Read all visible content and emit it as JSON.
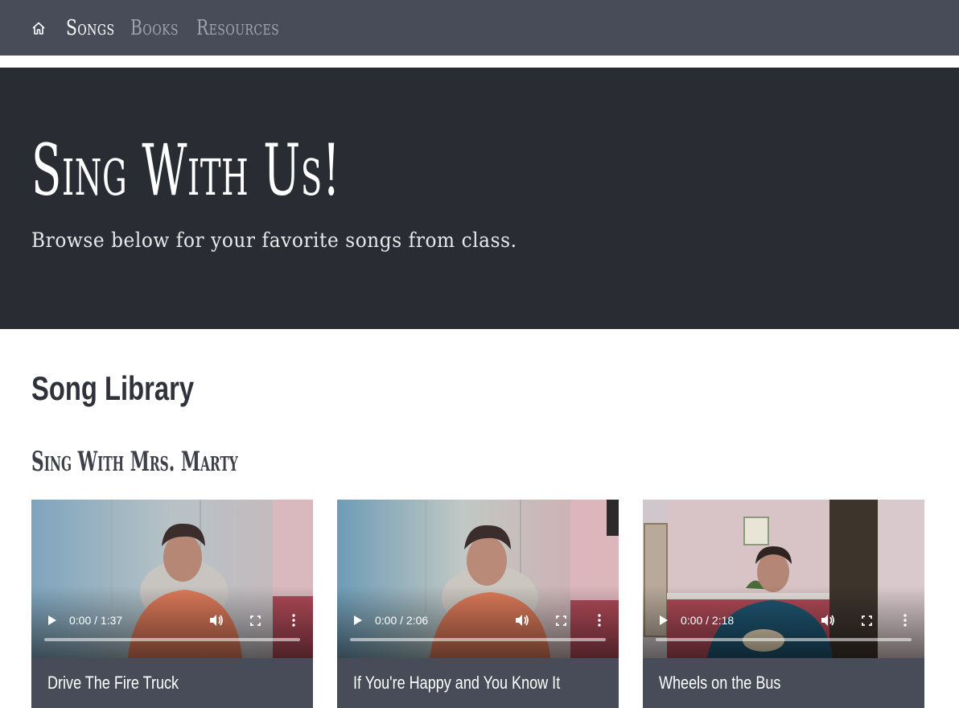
{
  "nav": {
    "home_icon": "home-icon",
    "links": [
      {
        "label": "Songs",
        "active": true
      },
      {
        "label": "Books",
        "active": false
      },
      {
        "label": "Resources",
        "active": false
      }
    ]
  },
  "hero": {
    "title": "Sing With Us!",
    "subtitle": "Browse below for your favorite songs from class."
  },
  "library": {
    "title": "Song Library",
    "subtitle": "Sing With Mrs. Marty"
  },
  "songs": [
    {
      "title": "Drive The Fire Truck",
      "time": "0:00 / 1:37",
      "progress": 0
    },
    {
      "title": "If You're Happy and You Know It",
      "time": "0:00 / 2:06",
      "progress": 0
    },
    {
      "title": "Wheels on the Bus",
      "time": "0:00 / 2:18",
      "progress": 0
    }
  ],
  "video_controls": {
    "play_icon": "play-icon",
    "volume_icon": "volume-icon",
    "fullscreen_icon": "fullscreen-icon",
    "more_icon": "more-options-icon"
  },
  "colors": {
    "nav_bg": "#474c58",
    "hero_bg": "#292c33",
    "card_bg": "#474c58",
    "nav_active": "#ffffff",
    "nav_inactive": "#9ea3ad"
  }
}
